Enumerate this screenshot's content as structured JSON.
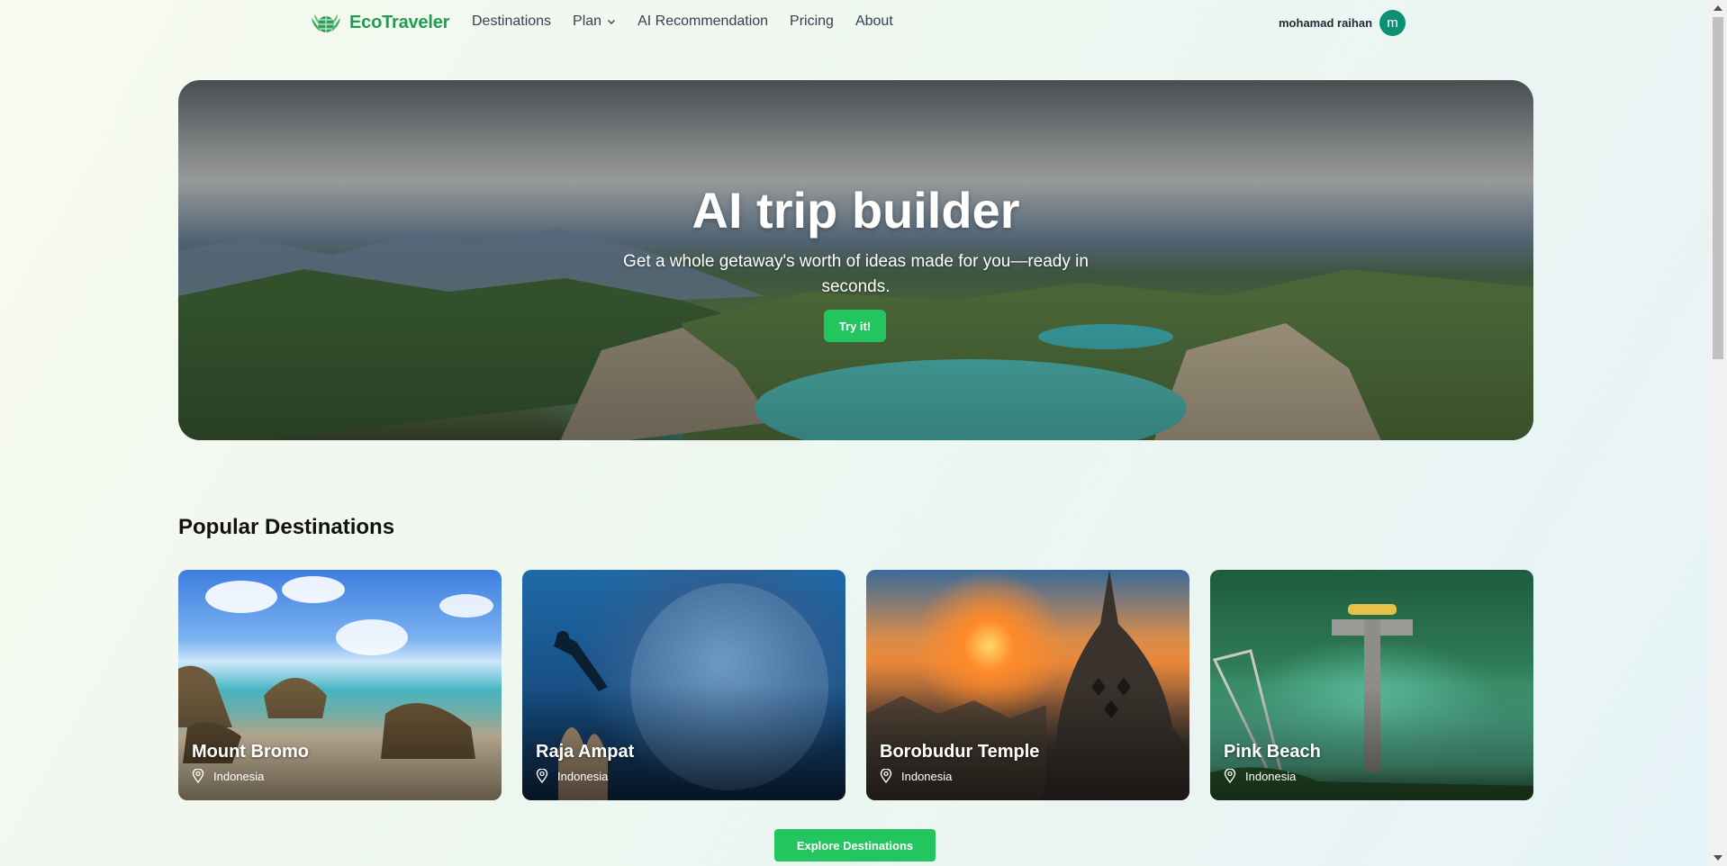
{
  "brand": {
    "name": "EcoTraveler",
    "color": "#1f9d55"
  },
  "nav": {
    "items": [
      {
        "label": "Destinations"
      },
      {
        "label": "Plan",
        "has_dropdown": true
      },
      {
        "label": "AI Recommendation"
      },
      {
        "label": "Pricing"
      },
      {
        "label": "About"
      }
    ]
  },
  "user": {
    "name": "mohamad raihan",
    "initial": "m",
    "avatar_color": "#0d8f76"
  },
  "hero": {
    "title": "AI trip builder",
    "subtitle": "Get a whole getaway's worth of ideas made for you—ready in seconds.",
    "cta": "Try it!"
  },
  "popular": {
    "title": "Popular Destinations",
    "cards": [
      {
        "name": "Mount Bromo",
        "location": "Indonesia"
      },
      {
        "name": "Raja Ampat",
        "location": "Indonesia"
      },
      {
        "name": "Borobudur Temple",
        "location": "Indonesia"
      },
      {
        "name": "Pink Beach",
        "location": "Indonesia"
      }
    ],
    "cta": "Explore Destinations"
  },
  "colors": {
    "accent": "#22c55e"
  },
  "icons": [
    "globe-leaf-logo-icon",
    "chevron-down-icon",
    "map-pin-icon"
  ]
}
